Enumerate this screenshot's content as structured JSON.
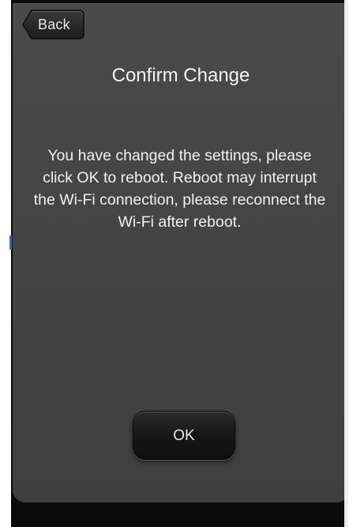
{
  "nav": {
    "back_label": "Back"
  },
  "dialog": {
    "title": "Confirm Change",
    "message": "You have changed the settings, please click OK to reboot. Reboot may interrupt the Wi-Fi connection, please reconnect the Wi-Fi after reboot.",
    "ok_label": "OK"
  },
  "colors": {
    "panel_bg": "#454545",
    "frame_bg": "#0b0b0b",
    "text": "#f0f0f0",
    "button_bg": "#151515"
  },
  "icons": {
    "back": "back-arrow-button-shape"
  }
}
